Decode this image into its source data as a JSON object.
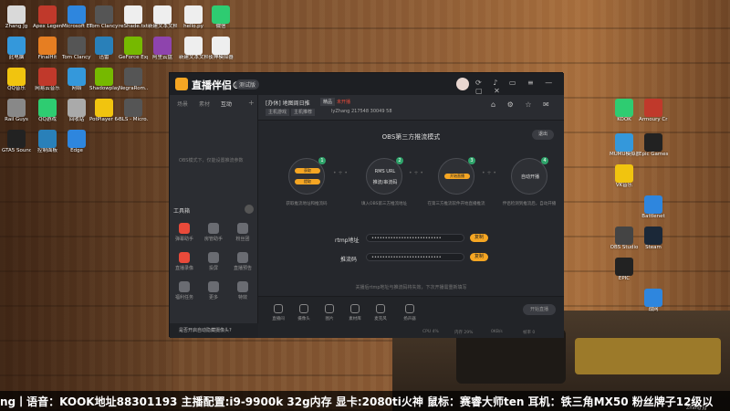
{
  "desktop": {
    "icons": [
      {
        "label": "Zhang Jg",
        "color": "#d9d9d9"
      },
      {
        "label": "Apex Legends",
        "color": "#c0392b"
      },
      {
        "label": "Microsoft Edge",
        "color": "#2e86de"
      },
      {
        "label": "Tom Clancy's...",
        "color": "#555"
      },
      {
        "label": "reShade.txt",
        "color": "#eee"
      },
      {
        "label": "新建文本文档.txt",
        "color": "#eee"
      },
      {
        "label": "hello.py",
        "color": "#eee"
      },
      {
        "label": "微信",
        "color": "#2ecc71"
      },
      {
        "label": "此电脑",
        "color": "#3498db"
      },
      {
        "label": "FinalHit",
        "color": "#e67e22"
      },
      {
        "label": "Tom Clancy's...",
        "color": "#555"
      },
      {
        "label": "迅雷",
        "color": "#2980b9"
      },
      {
        "label": "GeForce Experience",
        "color": "#76b900"
      },
      {
        "label": "阿里云盘",
        "color": "#8e44ad"
      },
      {
        "label": "新建文本文档.TXT",
        "color": "#eee"
      },
      {
        "label": "夜神模拟器",
        "color": "#eee"
      },
      {
        "label": "QQ音乐",
        "color": "#f1c40f"
      },
      {
        "label": "网易云音乐",
        "color": "#c0392b"
      },
      {
        "label": "网络",
        "color": "#3498db"
      },
      {
        "label": "Shadowplay",
        "color": "#76b900"
      },
      {
        "label": "NegraRom...",
        "color": "#555"
      },
      {
        "label": "Rail Guys",
        "color": "#888"
      },
      {
        "label": "QQ游戏",
        "color": "#2ecc71"
      },
      {
        "label": "回收站",
        "color": "#aaa"
      },
      {
        "label": "PotPlayer 64 bit",
        "color": "#f1c40f"
      },
      {
        "label": "BLS - Micro...",
        "color": "#555"
      },
      {
        "label": "GTA5 Soundtrack",
        "color": "#222"
      },
      {
        "label": "控制面板",
        "color": "#2980b9"
      },
      {
        "label": "Edge",
        "color": "#2e86de"
      }
    ],
    "right_icons": [
      {
        "label": "KOOK",
        "color": "#2ecc71"
      },
      {
        "label": "Armoury Crate",
        "color": "#c0392b"
      },
      {
        "label": "MUMU模拟器",
        "color": "#3498db"
      },
      {
        "label": "Epic Games Launcher",
        "color": "#222"
      },
      {
        "label": "VK音乐",
        "color": "#f1c40f"
      },
      {
        "label": "Battlenet",
        "color": "#2e86de"
      },
      {
        "label": "OBS Studio",
        "color": "#444"
      },
      {
        "label": "Steam",
        "color": "#1b2838"
      },
      {
        "label": "EPIC",
        "color": "#222"
      },
      {
        "label": "战网",
        "color": "#2e86de"
      }
    ]
  },
  "app": {
    "title": "直播伴侣®",
    "beta": "测试版",
    "tabs": [
      "场景",
      "素材",
      "互动",
      "互动插件"
    ],
    "left_hint": "OBS模式下，仅能设置推流参数",
    "tools_title": "工具箱",
    "tools": [
      {
        "label": "弹幕助手",
        "icon": "chat-icon",
        "red": true
      },
      {
        "label": "房管助手",
        "icon": "user-icon",
        "red": false
      },
      {
        "label": "粉丝团",
        "icon": "heart-icon",
        "red": false
      },
      {
        "label": "直播录像",
        "icon": "record-icon",
        "red": true
      },
      {
        "label": "投屏",
        "icon": "cast-icon",
        "red": false
      },
      {
        "label": "直播预告",
        "icon": "calendar-icon",
        "red": false
      },
      {
        "label": "福利任务",
        "icon": "gift-icon",
        "red": false
      },
      {
        "label": "更多",
        "icon": "more-icon",
        "red": false
      },
      {
        "label": "特效",
        "icon": "sparkle-icon",
        "red": false
      }
    ],
    "warn_text": "是否开启自动隐藏摄像头?",
    "room": {
      "title": "[办休] 地图周日推",
      "tag": "精品",
      "live_badge": "未开播",
      "categories": [
        "主机游戏",
        "主机推荐"
      ],
      "user": "lyZhang",
      "followers": "217548",
      "fans": "30049",
      "viewers": "58"
    },
    "obs": {
      "title": "OBS第三方推流模式",
      "exit": "退出",
      "steps": [
        {
          "num": "1",
          "top": "获取",
          "bottom": "提取",
          "desc": "获取推流地址和推流码"
        },
        {
          "num": "2",
          "top": "RMS URL",
          "bottom": "推流/串流码",
          "desc": "填入OBS第三方推流地址"
        },
        {
          "num": "3",
          "top": "开始直播",
          "bottom": "",
          "desc": "在第三方推流软件开始直播推流"
        },
        {
          "num": "4",
          "top": "自动开播",
          "bottom": "",
          "desc": "伴侣检测到推流后，自动开播"
        }
      ],
      "rtmp_label": "rtmp地址",
      "rtmp_value": "••••••••••••••••••••••••••",
      "key_label": "推流码",
      "key_value": "••••••••••••••••••••••••••",
      "copy": "复制",
      "note": "关播后rtmp地址与推流码将失效，下次开播需重新填写"
    },
    "toolbar": [
      {
        "label": "直播间",
        "icon": "monitor-icon"
      },
      {
        "label": "摄像头",
        "icon": "camera-icon"
      },
      {
        "label": "图片",
        "icon": "image-icon"
      },
      {
        "label": "素材库",
        "icon": "library-icon"
      },
      {
        "label": "麦克风",
        "icon": "mic-icon"
      },
      {
        "label": "扬声器",
        "icon": "speaker-icon"
      }
    ],
    "start_button": "开始直播",
    "status": {
      "cpu": "CPU 4%",
      "mem": "内存 29%",
      "net": "0KB/s",
      "fps": "帧率 0"
    }
  },
  "ticker": "ng丨语音：KOOK地址88301193  主播配置:i9-9900k 32g内存  显卡:2080ti火神  鼠标：赛睿大师ten  耳机：铁三角MX50  粉丝牌子12级以",
  "watermark": "Zhang Jg"
}
